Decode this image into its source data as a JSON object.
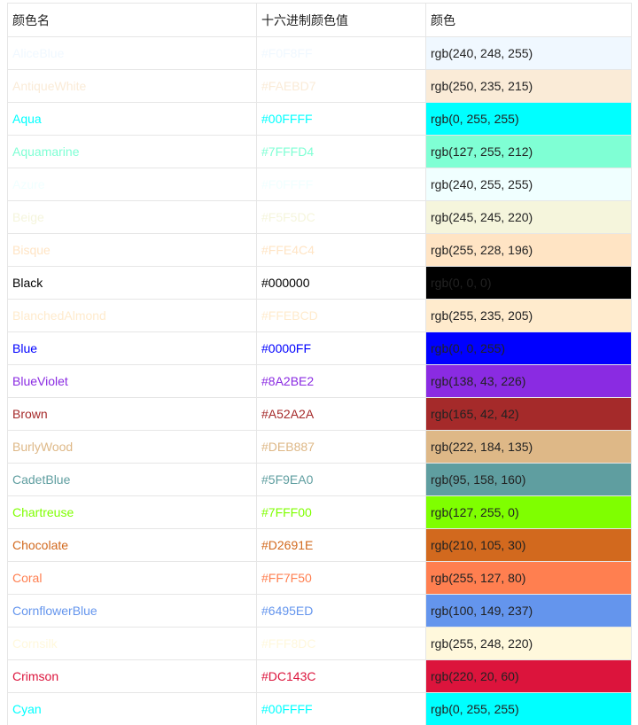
{
  "table": {
    "headers": [
      "颜色名",
      "十六进制颜色值",
      "颜色"
    ],
    "rows": [
      {
        "name": "AliceBlue",
        "hex": "#F0F8FF",
        "rgb": "rgb(240, 248, 255)"
      },
      {
        "name": "AntiqueWhite",
        "hex": "#FAEBD7",
        "rgb": "rgb(250, 235, 215)"
      },
      {
        "name": "Aqua",
        "hex": "#00FFFF",
        "rgb": "rgb(0, 255, 255)"
      },
      {
        "name": "Aquamarine",
        "hex": "#7FFFD4",
        "rgb": "rgb(127, 255, 212)"
      },
      {
        "name": "Azure",
        "hex": "#F0FFFF",
        "rgb": "rgb(240, 255, 255)"
      },
      {
        "name": "Beige",
        "hex": "#F5F5DC",
        "rgb": "rgb(245, 245, 220)"
      },
      {
        "name": "Bisque",
        "hex": "#FFE4C4",
        "rgb": "rgb(255, 228, 196)"
      },
      {
        "name": "Black",
        "hex": "#000000",
        "rgb": "rgb(0, 0, 0)"
      },
      {
        "name": "BlanchedAlmond",
        "hex": "#FFEBCD",
        "rgb": "rgb(255, 235, 205)"
      },
      {
        "name": "Blue",
        "hex": "#0000FF",
        "rgb": "rgb(0, 0, 255)"
      },
      {
        "name": "BlueViolet",
        "hex": "#8A2BE2",
        "rgb": "rgb(138, 43, 226)"
      },
      {
        "name": "Brown",
        "hex": "#A52A2A",
        "rgb": "rgb(165, 42, 42)"
      },
      {
        "name": "BurlyWood",
        "hex": "#DEB887",
        "rgb": "rgb(222, 184, 135)"
      },
      {
        "name": "CadetBlue",
        "hex": "#5F9EA0",
        "rgb": "rgb(95, 158, 160)"
      },
      {
        "name": "Chartreuse",
        "hex": "#7FFF00",
        "rgb": "rgb(127, 255, 0)"
      },
      {
        "name": "Chocolate",
        "hex": "#D2691E",
        "rgb": "rgb(210, 105, 30)"
      },
      {
        "name": "Coral",
        "hex": "#FF7F50",
        "rgb": "rgb(255, 127, 80)"
      },
      {
        "name": "CornflowerBlue",
        "hex": "#6495ED",
        "rgb": "rgb(100, 149, 237)"
      },
      {
        "name": "Cornsilk",
        "hex": "#FFF8DC",
        "rgb": "rgb(255, 248, 220)"
      },
      {
        "name": "Crimson",
        "hex": "#DC143C",
        "rgb": "rgb(220, 20, 60)"
      },
      {
        "name": "Cyan",
        "hex": "#00FFFF",
        "rgb": "rgb(0, 255, 255)"
      }
    ]
  }
}
